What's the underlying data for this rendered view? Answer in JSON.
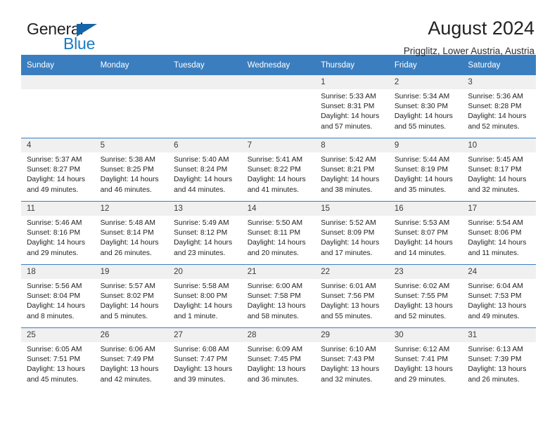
{
  "brand": {
    "name_top": "General",
    "name_bottom": "Blue",
    "accent_color": "#1a7bc4",
    "triangle_color": "#1565a8"
  },
  "header": {
    "title": "August 2024",
    "subtitle": "Prigglitz, Lower Austria, Austria"
  },
  "calendar": {
    "header_bg": "#3a7ec0",
    "daynum_bg": "#f0f0f0",
    "weekday_headers": [
      "Sunday",
      "Monday",
      "Tuesday",
      "Wednesday",
      "Thursday",
      "Friday",
      "Saturday"
    ],
    "weeks": [
      [
        {
          "day": "",
          "empty": true
        },
        {
          "day": "",
          "empty": true
        },
        {
          "day": "",
          "empty": true
        },
        {
          "day": "",
          "empty": true
        },
        {
          "day": "1",
          "sunrise": "Sunrise: 5:33 AM",
          "sunset": "Sunset: 8:31 PM",
          "daylight": "Daylight: 14 hours and 57 minutes."
        },
        {
          "day": "2",
          "sunrise": "Sunrise: 5:34 AM",
          "sunset": "Sunset: 8:30 PM",
          "daylight": "Daylight: 14 hours and 55 minutes."
        },
        {
          "day": "3",
          "sunrise": "Sunrise: 5:36 AM",
          "sunset": "Sunset: 8:28 PM",
          "daylight": "Daylight: 14 hours and 52 minutes."
        }
      ],
      [
        {
          "day": "4",
          "sunrise": "Sunrise: 5:37 AM",
          "sunset": "Sunset: 8:27 PM",
          "daylight": "Daylight: 14 hours and 49 minutes."
        },
        {
          "day": "5",
          "sunrise": "Sunrise: 5:38 AM",
          "sunset": "Sunset: 8:25 PM",
          "daylight": "Daylight: 14 hours and 46 minutes."
        },
        {
          "day": "6",
          "sunrise": "Sunrise: 5:40 AM",
          "sunset": "Sunset: 8:24 PM",
          "daylight": "Daylight: 14 hours and 44 minutes."
        },
        {
          "day": "7",
          "sunrise": "Sunrise: 5:41 AM",
          "sunset": "Sunset: 8:22 PM",
          "daylight": "Daylight: 14 hours and 41 minutes."
        },
        {
          "day": "8",
          "sunrise": "Sunrise: 5:42 AM",
          "sunset": "Sunset: 8:21 PM",
          "daylight": "Daylight: 14 hours and 38 minutes."
        },
        {
          "day": "9",
          "sunrise": "Sunrise: 5:44 AM",
          "sunset": "Sunset: 8:19 PM",
          "daylight": "Daylight: 14 hours and 35 minutes."
        },
        {
          "day": "10",
          "sunrise": "Sunrise: 5:45 AM",
          "sunset": "Sunset: 8:17 PM",
          "daylight": "Daylight: 14 hours and 32 minutes."
        }
      ],
      [
        {
          "day": "11",
          "sunrise": "Sunrise: 5:46 AM",
          "sunset": "Sunset: 8:16 PM",
          "daylight": "Daylight: 14 hours and 29 minutes."
        },
        {
          "day": "12",
          "sunrise": "Sunrise: 5:48 AM",
          "sunset": "Sunset: 8:14 PM",
          "daylight": "Daylight: 14 hours and 26 minutes."
        },
        {
          "day": "13",
          "sunrise": "Sunrise: 5:49 AM",
          "sunset": "Sunset: 8:12 PM",
          "daylight": "Daylight: 14 hours and 23 minutes."
        },
        {
          "day": "14",
          "sunrise": "Sunrise: 5:50 AM",
          "sunset": "Sunset: 8:11 PM",
          "daylight": "Daylight: 14 hours and 20 minutes."
        },
        {
          "day": "15",
          "sunrise": "Sunrise: 5:52 AM",
          "sunset": "Sunset: 8:09 PM",
          "daylight": "Daylight: 14 hours and 17 minutes."
        },
        {
          "day": "16",
          "sunrise": "Sunrise: 5:53 AM",
          "sunset": "Sunset: 8:07 PM",
          "daylight": "Daylight: 14 hours and 14 minutes."
        },
        {
          "day": "17",
          "sunrise": "Sunrise: 5:54 AM",
          "sunset": "Sunset: 8:06 PM",
          "daylight": "Daylight: 14 hours and 11 minutes."
        }
      ],
      [
        {
          "day": "18",
          "sunrise": "Sunrise: 5:56 AM",
          "sunset": "Sunset: 8:04 PM",
          "daylight": "Daylight: 14 hours and 8 minutes."
        },
        {
          "day": "19",
          "sunrise": "Sunrise: 5:57 AM",
          "sunset": "Sunset: 8:02 PM",
          "daylight": "Daylight: 14 hours and 5 minutes."
        },
        {
          "day": "20",
          "sunrise": "Sunrise: 5:58 AM",
          "sunset": "Sunset: 8:00 PM",
          "daylight": "Daylight: 14 hours and 1 minute."
        },
        {
          "day": "21",
          "sunrise": "Sunrise: 6:00 AM",
          "sunset": "Sunset: 7:58 PM",
          "daylight": "Daylight: 13 hours and 58 minutes."
        },
        {
          "day": "22",
          "sunrise": "Sunrise: 6:01 AM",
          "sunset": "Sunset: 7:56 PM",
          "daylight": "Daylight: 13 hours and 55 minutes."
        },
        {
          "day": "23",
          "sunrise": "Sunrise: 6:02 AM",
          "sunset": "Sunset: 7:55 PM",
          "daylight": "Daylight: 13 hours and 52 minutes."
        },
        {
          "day": "24",
          "sunrise": "Sunrise: 6:04 AM",
          "sunset": "Sunset: 7:53 PM",
          "daylight": "Daylight: 13 hours and 49 minutes."
        }
      ],
      [
        {
          "day": "25",
          "sunrise": "Sunrise: 6:05 AM",
          "sunset": "Sunset: 7:51 PM",
          "daylight": "Daylight: 13 hours and 45 minutes."
        },
        {
          "day": "26",
          "sunrise": "Sunrise: 6:06 AM",
          "sunset": "Sunset: 7:49 PM",
          "daylight": "Daylight: 13 hours and 42 minutes."
        },
        {
          "day": "27",
          "sunrise": "Sunrise: 6:08 AM",
          "sunset": "Sunset: 7:47 PM",
          "daylight": "Daylight: 13 hours and 39 minutes."
        },
        {
          "day": "28",
          "sunrise": "Sunrise: 6:09 AM",
          "sunset": "Sunset: 7:45 PM",
          "daylight": "Daylight: 13 hours and 36 minutes."
        },
        {
          "day": "29",
          "sunrise": "Sunrise: 6:10 AM",
          "sunset": "Sunset: 7:43 PM",
          "daylight": "Daylight: 13 hours and 32 minutes."
        },
        {
          "day": "30",
          "sunrise": "Sunrise: 6:12 AM",
          "sunset": "Sunset: 7:41 PM",
          "daylight": "Daylight: 13 hours and 29 minutes."
        },
        {
          "day": "31",
          "sunrise": "Sunrise: 6:13 AM",
          "sunset": "Sunset: 7:39 PM",
          "daylight": "Daylight: 13 hours and 26 minutes."
        }
      ]
    ]
  }
}
